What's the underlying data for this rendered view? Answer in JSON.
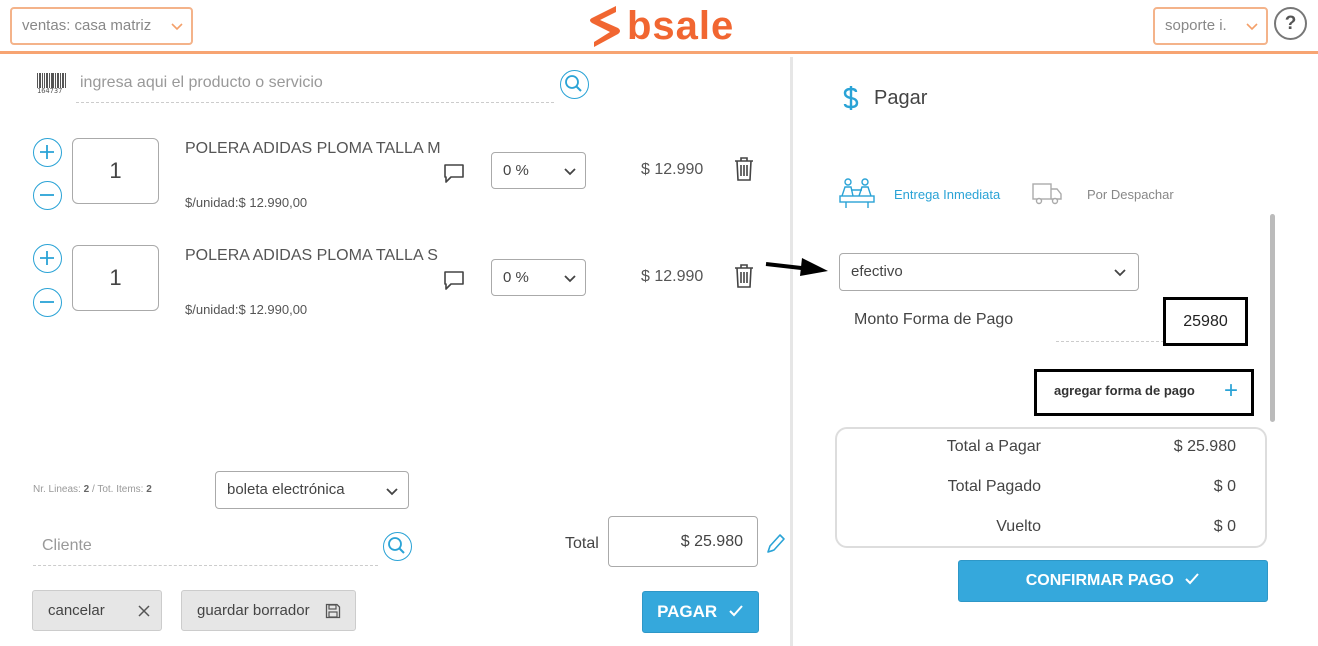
{
  "header": {
    "branch_select": "ventas: casa matriz",
    "brand": "bsale",
    "user_select": "soporte i.",
    "help_label": "?"
  },
  "search": {
    "placeholder": "ingresa aqui el producto o servicio",
    "barcode_digits": "164737"
  },
  "items": [
    {
      "qty": "1",
      "name": "POLERA ADIDAS PLOMA TALLA M",
      "unit_price": "$/unidad:$ 12.990,00",
      "discount": "0 %",
      "price": "$ 12.990"
    },
    {
      "qty": "1",
      "name": "POLERA ADIDAS PLOMA TALLA S",
      "unit_price": "$/unidad:$ 12.990,00",
      "discount": "0 %",
      "price": "$ 12.990"
    }
  ],
  "footer": {
    "lines_label": "Nr. Lineas:",
    "lines_value": "2",
    "items_label": "/ Tot. Items:",
    "items_value": "2",
    "doc_type": "boleta electrónica",
    "client_placeholder": "Cliente",
    "total_label": "Total",
    "total_value": "$ 25.980",
    "cancel_label": "cancelar",
    "draft_label": "guardar borrador",
    "pay_label": "PAGAR"
  },
  "payment": {
    "title": "Pagar",
    "tab_immediate": "Entrega Inmediata",
    "tab_dispatch": "Por Despachar",
    "method": "efectivo",
    "amount_label": "Monto Forma de Pago",
    "amount_value": "25980",
    "add_method_label": "agregar forma de pago",
    "total_to_pay_label": "Total a Pagar",
    "total_to_pay_value": "$ 25.980",
    "total_paid_label": "Total Pagado",
    "total_paid_value": "$ 0",
    "change_label": "Vuelto",
    "change_value": "$ 0",
    "confirm_label": "CONFIRMAR PAGO"
  },
  "colors": {
    "brand_orange": "#f16631",
    "accent_blue": "#35a8dc"
  }
}
